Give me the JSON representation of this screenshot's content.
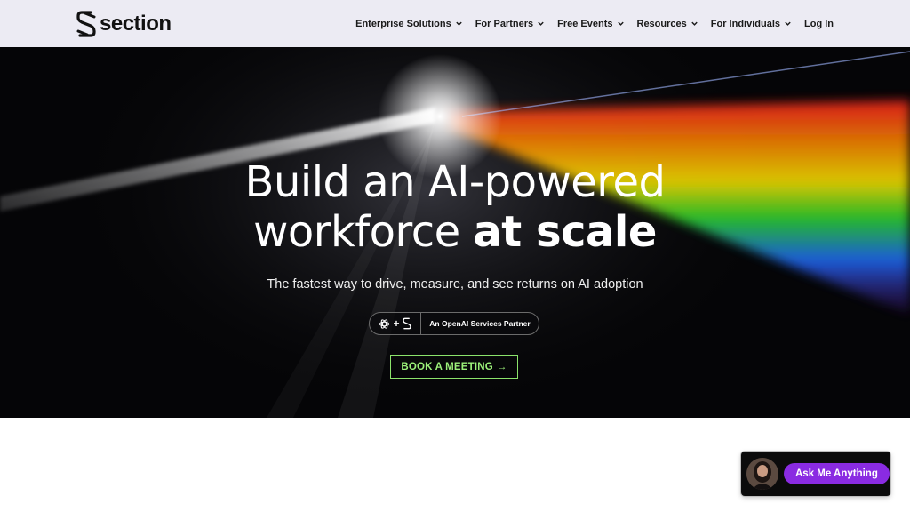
{
  "brand": {
    "name": "section"
  },
  "nav": {
    "items": [
      {
        "label": "Enterprise Solutions"
      },
      {
        "label": "For Partners"
      },
      {
        "label": "Free Events"
      },
      {
        "label": "Resources"
      },
      {
        "label": "For Individuals"
      }
    ],
    "login_label": "Log In"
  },
  "hero": {
    "title_line1": "Build an AI-powered",
    "title_line2_regular": "workforce",
    "title_line2_bold": "at scale",
    "subtitle": "The fastest way to drive, measure, and see returns on AI adoption",
    "partner_plus": "+",
    "partner_text": "An OpenAI Services Partner",
    "cta_label": "BOOK A MEETING",
    "cta_arrow": "→"
  },
  "chat": {
    "button_label": "Ask Me Anything"
  },
  "colors": {
    "header_bg": "#ecebf3",
    "hero_bg": "#050507",
    "cta_green": "#9cf07a",
    "chat_purple": "#8a2be2"
  },
  "icons": {
    "nav_dropdown": "chevron-down-icon",
    "partner_logos": [
      "openai-icon",
      "section-mark-icon"
    ],
    "cta": "arrow-right-icon"
  }
}
